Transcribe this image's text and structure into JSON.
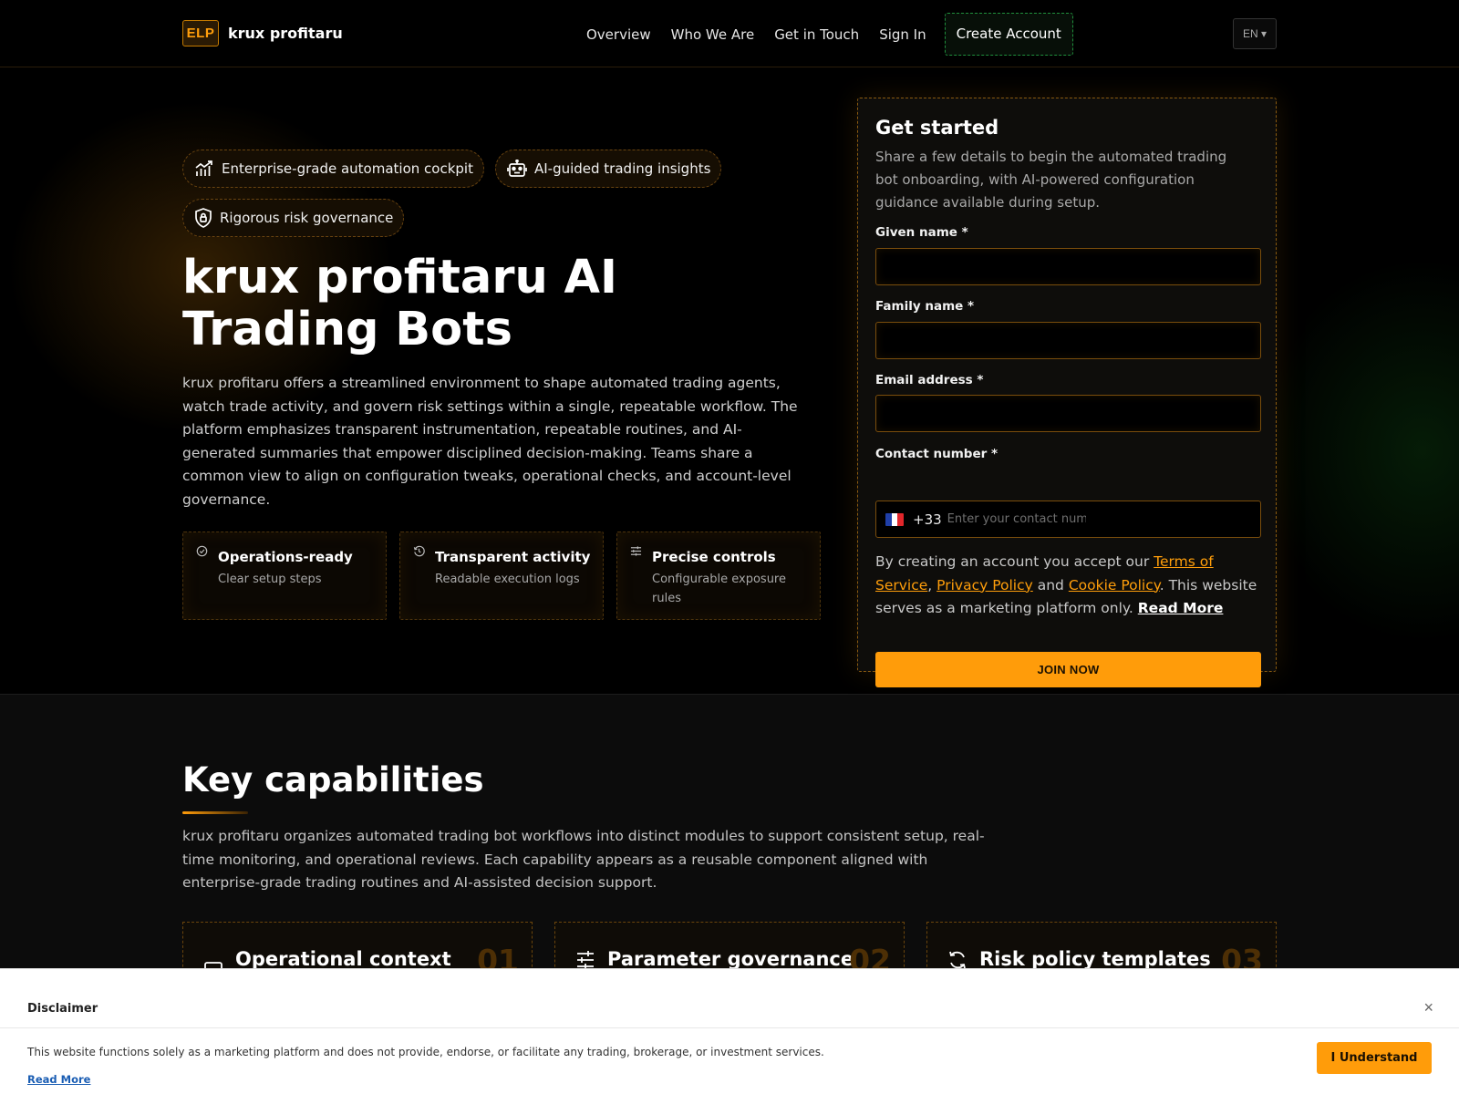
{
  "header": {
    "logo_badge": "ELP",
    "brand": "krux profitaru",
    "nav": {
      "overview": "Overview",
      "who_we_are": "Who We Are",
      "get_in_touch": "Get in Touch",
      "sign_in": "Sign In",
      "create_account": "Create Account"
    },
    "language": "EN ▾"
  },
  "hero": {
    "pills": {
      "p1": "Enterprise-grade automation cockpit",
      "p2": "AI-guided trading insights",
      "p3": "Rigorous risk governance"
    },
    "title": "krux profitaru AI Trading Bots",
    "description": "krux profitaru offers a streamlined environment to shape automated trading agents, watch trade activity, and govern risk settings within a single, repeatable workflow. The platform emphasizes transparent instrumentation, repeatable routines, and AI-generated summaries that empower disciplined decision-making. Teams share a common view to align on configuration tweaks, operational checks, and account-level governance.",
    "features": {
      "f1": {
        "title": "Operations-ready",
        "sub": "Clear setup steps"
      },
      "f2": {
        "title": "Transparent activity",
        "sub": "Readable execution logs"
      },
      "f3": {
        "title": "Precise controls",
        "sub": "Configurable exposure rules"
      }
    }
  },
  "form": {
    "title": "Get started",
    "description": "Share a few details to begin the automated trading bot onboarding, with AI-powered configuration guidance available during setup.",
    "given_name_label": "Given name *",
    "given_name_value": "",
    "family_name_label": "Family name *",
    "family_name_value": "",
    "email_label": "Email address *",
    "email_value": "",
    "contact_label": "Contact number *",
    "country_code": "+33",
    "contact_placeholder": "Enter your contact number",
    "terms_prefix": "By creating an account you accept our ",
    "terms_link": "Terms of Service",
    "terms_sep1": ", ",
    "privacy_link": "Privacy Policy",
    "terms_sep2": " and ",
    "cookie_link": "Cookie Policy",
    "terms_suffix": ". This website serves as a marketing platform only. ",
    "read_more": "Read More",
    "submit": "JOIN NOW"
  },
  "capabilities": {
    "title": "Key capabilities",
    "description": "krux profitaru organizes automated trading bot workflows into distinct modules to support consistent setup, real-time monitoring, and operational reviews. Each capability appears as a reusable component aligned with enterprise-grade trading routines and AI-assisted decision support.",
    "cards": {
      "c1": {
        "title": "Operational context",
        "num": "01"
      },
      "c2": {
        "title": "Parameter governance",
        "num": "02"
      },
      "c3": {
        "title": "Risk policy templates",
        "num": "03"
      }
    }
  },
  "disclaimer": {
    "title": "Disclaimer",
    "close": "×",
    "text": "This website functions solely as a marketing platform and does not provide, endorse, or facilitate any trading, brokerage, or investment services.",
    "read_more": "Read More",
    "button": "I Understand"
  },
  "colors": {
    "accent": "#ff9c0a",
    "accent_dark": "#7a4d0c",
    "create_border": "#1f8f3c"
  },
  "icons": {
    "pill1": "chart-growth-icon",
    "pill2": "robot-icon",
    "pill3": "shield-lock-icon",
    "feature1": "check-circle-icon",
    "feature2": "history-icon",
    "feature3": "sliders-icon",
    "cap1": "monitor-icon",
    "cap2": "sliders-icon",
    "cap3": "refresh-icon",
    "close": "close-icon"
  }
}
